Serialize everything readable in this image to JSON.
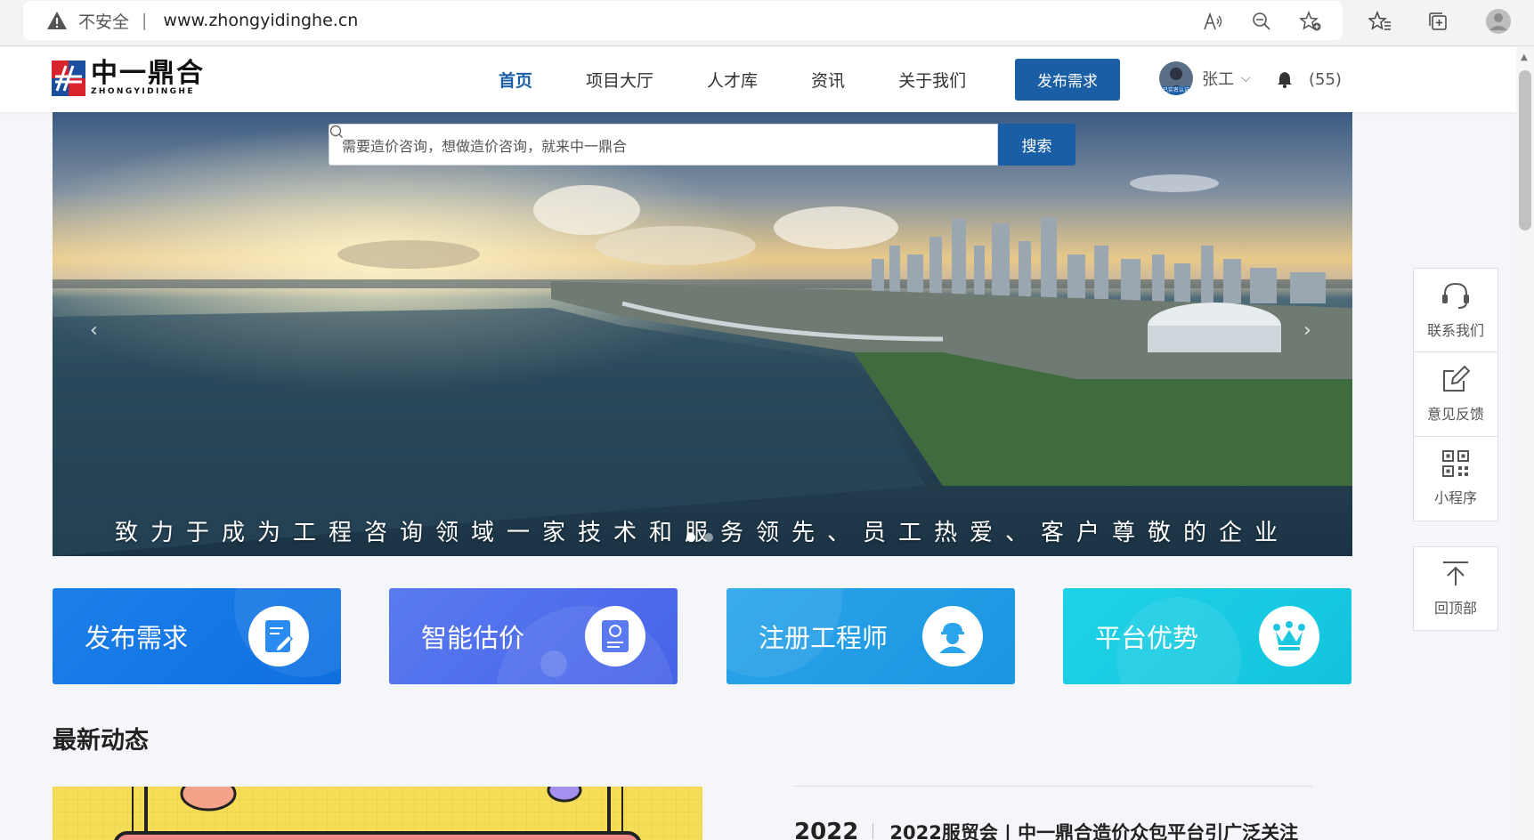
{
  "browser": {
    "insecure_label": "不安全",
    "url": "www.zhongyidinghe.cn"
  },
  "header": {
    "logo_cn": "中一鼎合",
    "logo_en": "ZHONGYIDINGHE",
    "nav": [
      "首页",
      "项目大厅",
      "人才库",
      "资讯",
      "关于我们"
    ],
    "active_nav": "首页",
    "publish_label": "发布需求",
    "user_name": "张工",
    "avatar_badge": "已实名认证",
    "notification_count": "(55)"
  },
  "banner": {
    "search_placeholder": "需要造价咨询，想做造价咨询，就来中一鼎合",
    "search_button": "搜索",
    "slogan": "致力于成为工程咨询领域一家技术和服务领先、员工热爱、客户尊敬的企业",
    "slide_count": 2,
    "active_slide": 0
  },
  "cards": [
    {
      "label": "发布需求",
      "icon": "edit-document-icon",
      "color": "#1b7fe9"
    },
    {
      "label": "智能估价",
      "icon": "document-search-icon",
      "color": "#5a7af0"
    },
    {
      "label": "注册工程师",
      "icon": "engineer-icon",
      "color": "#2aa4ea"
    },
    {
      "label": "平台优势",
      "icon": "crown-icon",
      "color": "#1fd2e6"
    }
  ],
  "news": {
    "section_title": "最新动态",
    "items": [
      {
        "year": "2022",
        "title": "2022服贸会 | 中一鼎合造价众包平台引广泛关注"
      }
    ]
  },
  "side_panel": {
    "items": [
      "联系我们",
      "意见反馈",
      "小程序"
    ],
    "back_to_top": "回顶部"
  },
  "colors": {
    "brand": "#1a5ea6",
    "background": "#f4f6f9"
  }
}
